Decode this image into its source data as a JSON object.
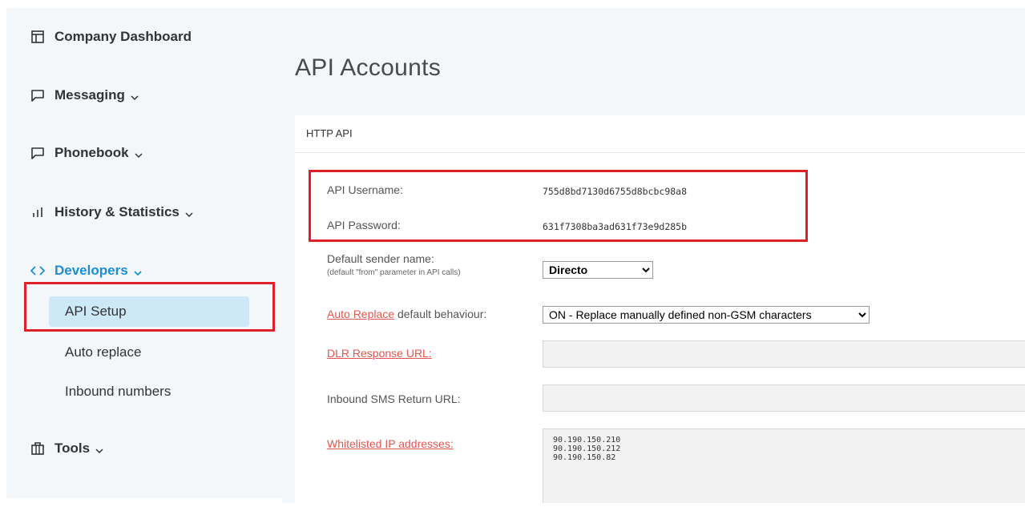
{
  "sidebar": {
    "company_dashboard": "Company Dashboard",
    "messaging": "Messaging",
    "phonebook": "Phonebook",
    "history": "History & Statistics",
    "developers": "Developers",
    "sub_items": [
      "API Setup",
      "Auto replace",
      "Inbound numbers"
    ],
    "tools": "Tools"
  },
  "main": {
    "title": "API Accounts",
    "card_title": "HTTP API",
    "api_username_label": "API Username:",
    "api_username_value": "755d8bd7130d6755d8bcbc98a8",
    "api_password_label": "API Password:",
    "api_password_value": "631f7308ba3ad631f73e9d285b",
    "sender_label": "Default sender name:",
    "sender_hint": "(default \"from\" parameter in API calls)",
    "sender_value": "Directo",
    "auto_replace_link": "Auto Replace",
    "auto_replace_rest": " default behaviour:",
    "auto_replace_value": "ON - Replace manually defined non-GSM characters",
    "dlr_label": "DLR Response URL:",
    "inbound_label": "Inbound SMS Return URL:",
    "whitelist_label": "Whitelisted IP addresses:",
    "whitelist_value": "90.190.150.210\n90.190.150.212\n90.190.150.82"
  },
  "colors": {
    "accent": "#1a8fd6",
    "highlight": "#e02027",
    "link": "#e0574f"
  }
}
